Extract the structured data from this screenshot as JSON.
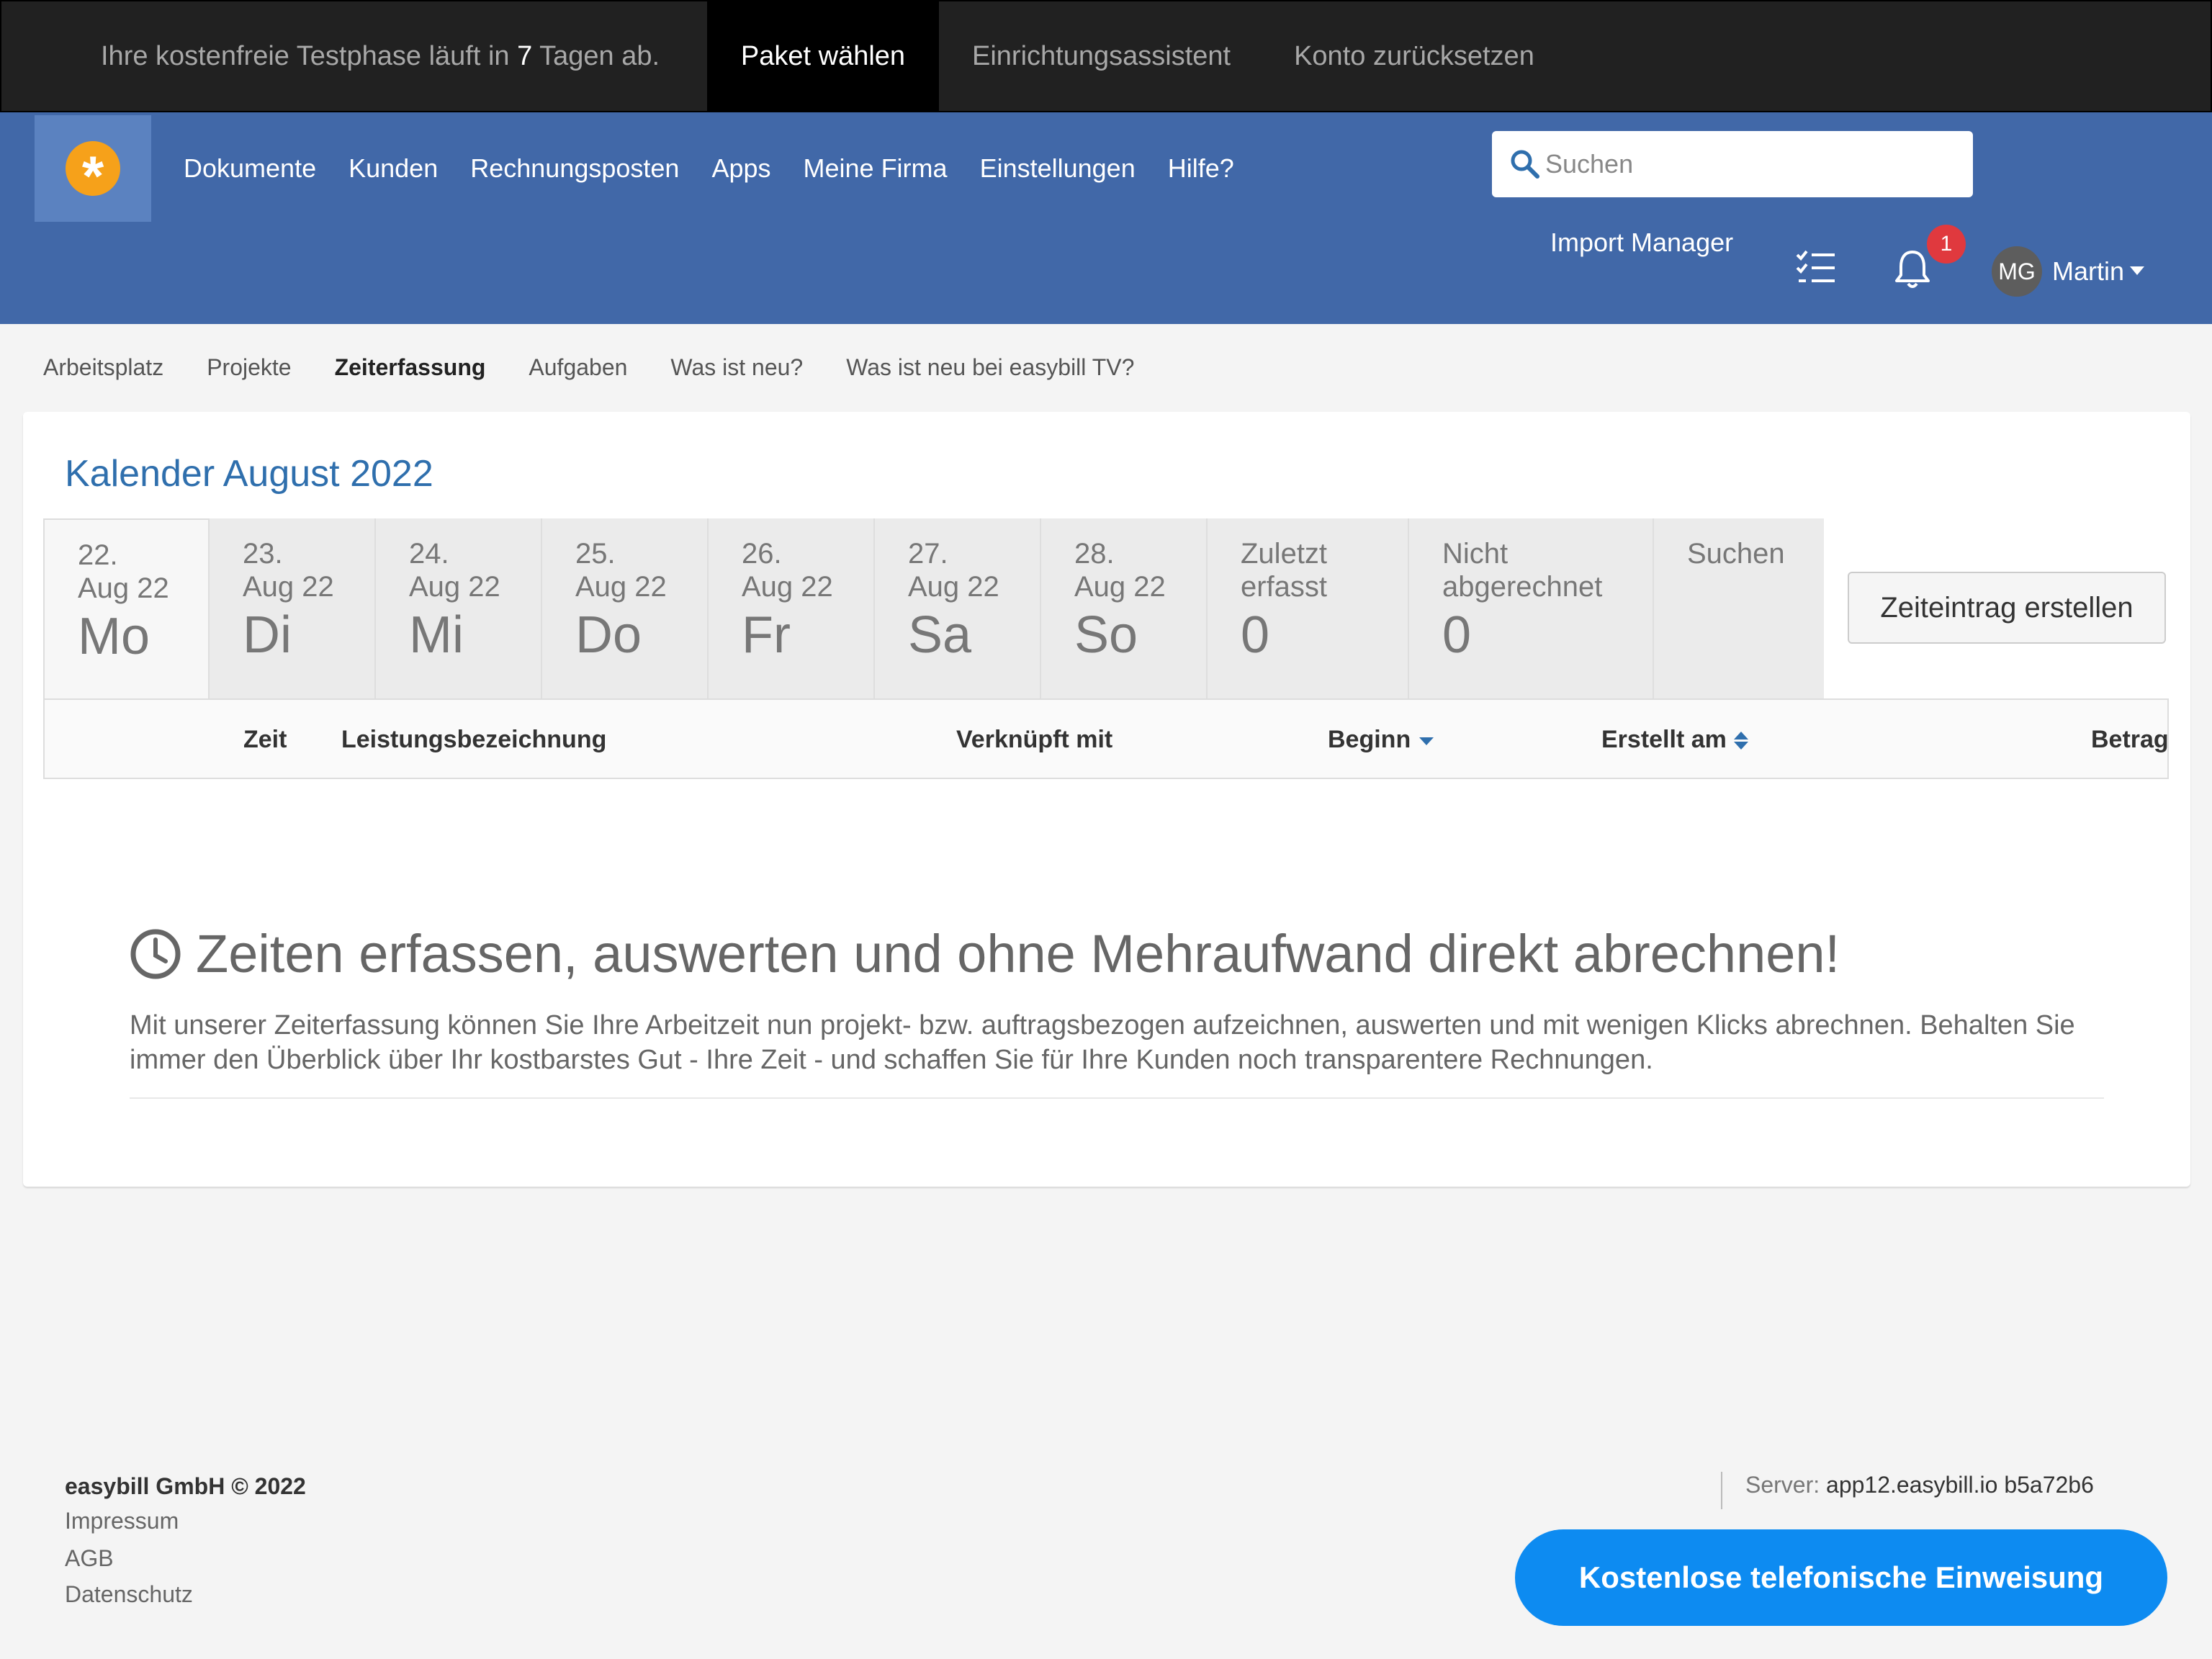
{
  "trial": {
    "message_prefix": "Ihre kostenfreie Testphase läuft in ",
    "days": "7",
    "message_suffix": " Tagen ab.",
    "plan_label": "Paket wählen",
    "wizard_label": "Einrichtungsassistent",
    "reset_label": "Konto zurücksetzen"
  },
  "nav": {
    "items": [
      "Dokumente",
      "Kunden",
      "Rechnungsposten",
      "Apps",
      "Meine Firma",
      "Einstellungen",
      "Hilfe?"
    ],
    "search_placeholder": "Suchen",
    "import_manager": "Import Manager",
    "notification_count": "1",
    "avatar_initials": "MG",
    "username": "Martin"
  },
  "subnav": {
    "items": [
      "Arbeitsplatz",
      "Projekte",
      "Zeiterfassung",
      "Aufgaben",
      "Was ist neu?",
      "Was ist neu bei easybill TV?"
    ],
    "active_index": 2
  },
  "calendar": {
    "title": "Kalender August 2022",
    "days": [
      {
        "date": "22.",
        "month": "Aug 22",
        "weekday": "Mo"
      },
      {
        "date": "23.",
        "month": "Aug 22",
        "weekday": "Di"
      },
      {
        "date": "24.",
        "month": "Aug 22",
        "weekday": "Mi"
      },
      {
        "date": "25.",
        "month": "Aug 22",
        "weekday": "Do"
      },
      {
        "date": "26.",
        "month": "Aug 22",
        "weekday": "Fr"
      },
      {
        "date": "27.",
        "month": "Aug 22",
        "weekday": "Sa"
      },
      {
        "date": "28.",
        "month": "Aug 22",
        "weekday": "So"
      }
    ],
    "last_recorded": {
      "line1": "Zuletzt",
      "line2": "erfasst",
      "value": "0"
    },
    "not_billed": {
      "line1": "Nicht",
      "line2": "abgerechnet",
      "value": "0"
    },
    "search_tab": "Suchen",
    "create_button": "Zeiteintrag erstellen"
  },
  "table": {
    "headers": {
      "time": "Zeit",
      "description": "Leistungsbezeichnung",
      "linked": "Verknüpft mit",
      "start": "Beginn",
      "created": "Erstellt am",
      "amount": "Betrag"
    }
  },
  "promo": {
    "title": "Zeiten erfassen, auswerten und ohne Mehraufwand direkt abrechnen!",
    "text": "Mit unserer Zeiterfassung können Sie Ihre Arbeitzeit nun projekt- bzw. auftragsbezogen aufzeichnen, auswerten und mit wenigen Klicks abrechnen. Behalten Sie immer den Überblick über Ihr kostbarstes Gut - Ihre Zeit - und schaffen Sie für Ihre Kunden noch transparentere Rechnungen."
  },
  "footer": {
    "company": "easybill GmbH © 2022",
    "links": [
      "Impressum",
      "AGB",
      "Datenschutz"
    ],
    "server_label": "Server:",
    "server_value": "app12.easybill.io b5a72b6",
    "cta": "Kostenlose telefonische Einweisung"
  },
  "colors": {
    "nav_bg": "#4168a8",
    "trial_bg": "#212121",
    "accent_link": "#2f6fad",
    "logo": "#f6a11a",
    "cta": "#0d8bf1",
    "badge": "#e0393e"
  }
}
